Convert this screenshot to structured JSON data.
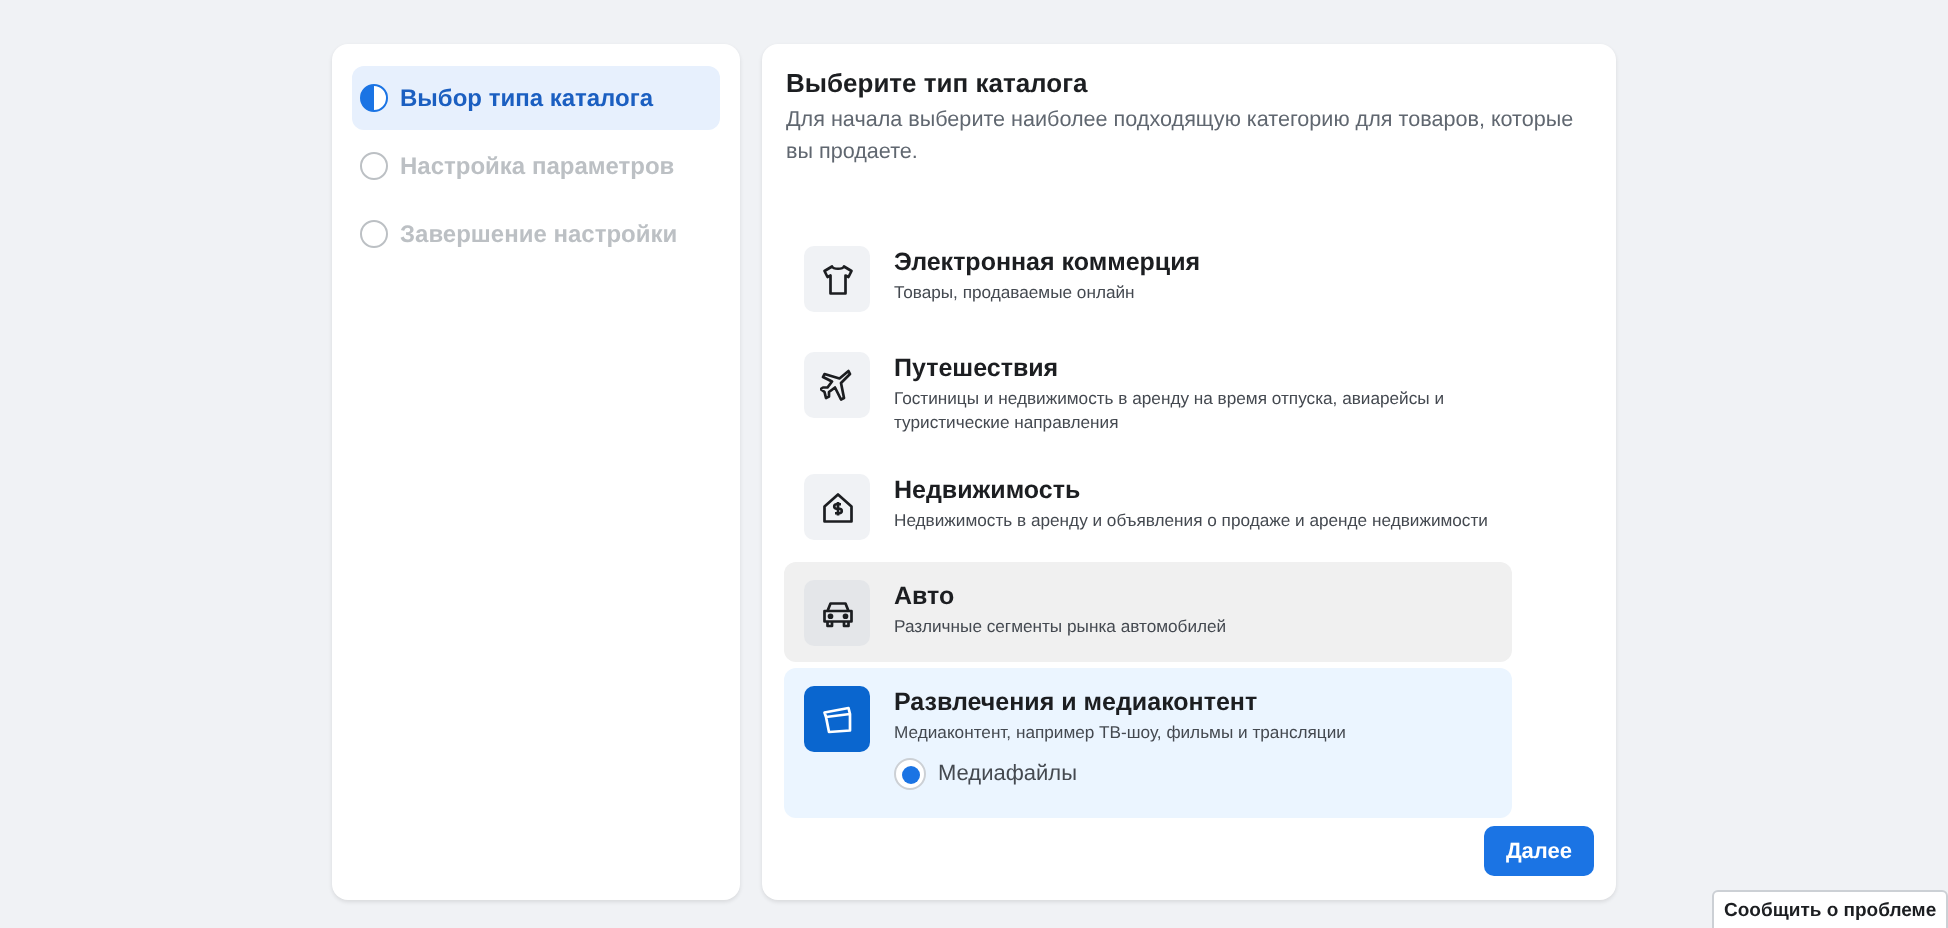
{
  "steps": [
    {
      "label": "Выбор типа каталога",
      "selected": true
    },
    {
      "label": "Настройка параметров",
      "selected": false
    },
    {
      "label": "Завершение настройки",
      "selected": false
    }
  ],
  "main": {
    "title": "Выберите тип каталога",
    "subtitle": "Для начала выберите наиболее подходящую категорию для товаров, которые вы продаете."
  },
  "categories": [
    {
      "kind": "shirt",
      "title": "Электронная коммерция",
      "description": "Товары, продаваемые онлайн",
      "selected": false,
      "highlighted": false
    },
    {
      "kind": "plane",
      "title": "Путешествия",
      "description": "Гостиницы и недвижимость в аренду на время отпуска, авиарейсы и туристические направления",
      "selected": false,
      "highlighted": false
    },
    {
      "kind": "house",
      "title": "Недвижимость",
      "description": "Недвижимость в аренду и объявления о продаже и аренде недвижимости",
      "selected": false,
      "highlighted": false
    },
    {
      "kind": "car",
      "title": "Авто",
      "description": "Различные сегменты рынка автомобилей",
      "selected": false,
      "highlighted": true
    },
    {
      "kind": "clapper",
      "title": "Развлечения и медиаконтент",
      "description": "Медиаконтент, например ТВ-шоу, фильмы и трансляции",
      "selected": true,
      "highlighted": false,
      "options": [
        {
          "label": "Медиафайлы",
          "selected": true
        }
      ]
    }
  ],
  "next_button": "Далее",
  "report_button": "Сообщить о проблеме"
}
